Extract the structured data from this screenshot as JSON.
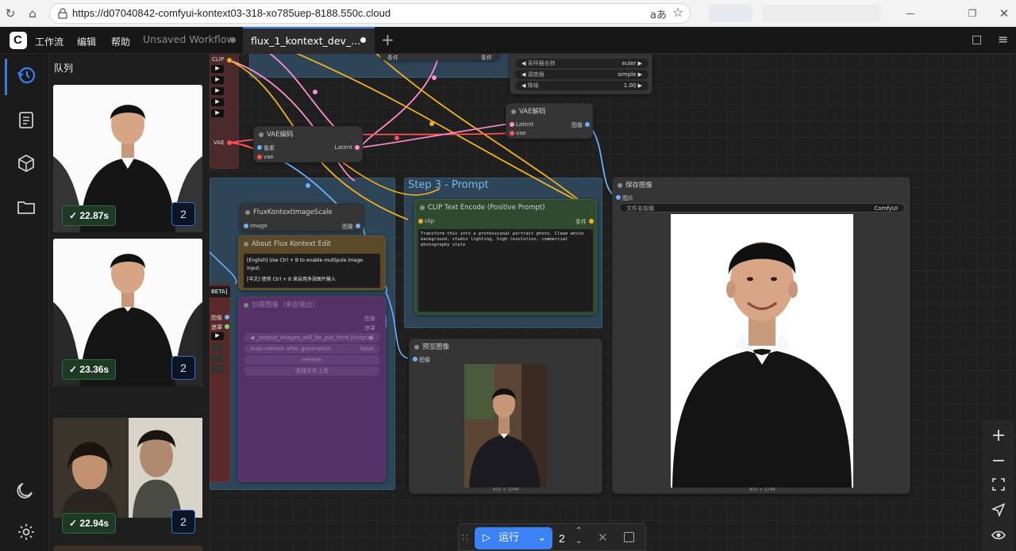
{
  "browser": {
    "url": "https://d07040842-comfyui-kontext03-318-xo785uep-8188.550c.cloud",
    "reload_icon": "reload-icon",
    "home_icon": "home-icon",
    "read_aloud_icon": "read-aloud-icon",
    "favorite_icon": "star-icon"
  },
  "menu": {
    "workflow": "工作流",
    "edit": "编辑",
    "help": "帮助"
  },
  "tabs": [
    {
      "label": "Unsaved Workflow",
      "active": false
    },
    {
      "label": "flux_1_kontext_dev_...",
      "active": true
    }
  ],
  "queue": {
    "title": "队列",
    "items": [
      {
        "time": "22.87s",
        "count": "2"
      },
      {
        "time": "23.36s",
        "count": "2"
      },
      {
        "time": "22.94s",
        "count": "2"
      }
    ]
  },
  "groups": {
    "step3": "Step 3 - Prompt"
  },
  "nodes": {
    "sampler": {
      "sampler_label": "采样器名称",
      "sampler_value": "euler",
      "scheduler_label": "调度器",
      "scheduler_value": "simple",
      "denoise_label": "降噪",
      "denoise_value": "1.00",
      "cond_left": "条件",
      "cond_right": "条件"
    },
    "vae_decode": {
      "title": "VAE解码",
      "in1": "Latent",
      "in2": "vae",
      "out": "图像"
    },
    "vae_encode": {
      "title": "VAE编码",
      "in1": "像素",
      "in2": "vae",
      "out": "Latent"
    },
    "left_ports": {
      "clip": "CLIP",
      "vae": "VAE"
    },
    "scale": {
      "title": "FluxKontextImageScale",
      "in": "image",
      "out": "图像"
    },
    "about": {
      "title": "About Flux Kontext Edit",
      "line1": "[English] Use Ctrl + B to enable multipule image input.",
      "line2": "[中文] 使用 Ctrl + B 来启用多张图片输入"
    },
    "clip_encode": {
      "title": "CLIP Text Encode (Positive Prompt)",
      "in": "clip",
      "out": "条件",
      "prompt": "Transform this into a professional portrait photo. Clean white background, studio lighting, high resolution, commercial photography style"
    },
    "load_image": {
      "title": "加载图像（来自输出）",
      "beta": "BETA]",
      "out1": "图像",
      "out2": "遮罩",
      "r1": "图像",
      "r2": "遮罩",
      "file": "_output_images_will_be_put_here [output]",
      "auto_refresh": "Auto refresh after generation",
      "auto_value": "false",
      "refresh": "refresh",
      "upload": "选择文件上传"
    },
    "preview": {
      "title": "预览图像",
      "in": "图像",
      "dims": "832 × 1248"
    },
    "save": {
      "title": "保存图像",
      "in": "图片",
      "prefix_label": "文件名前缀",
      "prefix_value": "ComfyUI",
      "dims": "832 × 1248"
    }
  },
  "runbar": {
    "run_label": "运行",
    "count": "2"
  },
  "colors": {
    "accent": "#3b82f6",
    "group_blue": "#2f4a5e",
    "node_green": "#2f4a2f",
    "node_brown": "#5a4a2a",
    "node_purple": "#5a2f6a",
    "link_yellow": "#f0b020",
    "link_pink": "#ff8fd0",
    "link_blue": "#6ab0ff",
    "link_red": "#ff5050"
  }
}
